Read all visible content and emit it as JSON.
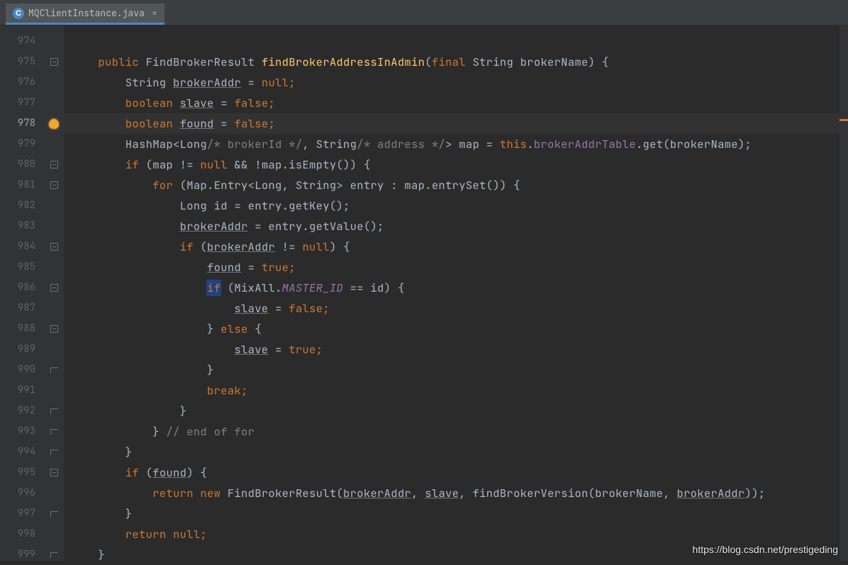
{
  "tab": {
    "filename": "MQClientInstance.java",
    "icon_letter": "C"
  },
  "gutter": {
    "start": 974,
    "end": 999,
    "current": 978
  },
  "code": {
    "l974": "",
    "l975_kw_public": "public",
    "l975_type": " FindBrokerResult ",
    "l975_method": "findBrokerAddressInAdmin",
    "l975_after": "(",
    "l975_final": "final",
    "l975_rest": " String brokerName) {",
    "l976_pre": "        String ",
    "l976_var": "brokerAddr",
    "l976_post": " = ",
    "l976_null": "null",
    "l976_semi": ";",
    "l977_pre": "        ",
    "l977_bool": "boolean ",
    "l977_var": "slave",
    "l977_eq": " = ",
    "l977_val": "false",
    "l977_semi": ";",
    "l978_pre": "        ",
    "l978_bool": "boolean ",
    "l978_var": "found",
    "l978_eq": " = ",
    "l978_val": "false",
    "l978_semi": ";",
    "l979_pre": "        HashMap<Long",
    "l979_c1": "/* brokerId */",
    "l979_mid": ", String",
    "l979_c2": "/* address */",
    "l979_mid2": "> map = ",
    "l979_this": "this",
    "l979_dot": ".",
    "l979_field": "brokerAddrTable",
    "l979_rest": ".get(brokerName);",
    "l980_pre": "        ",
    "l980_if": "if",
    "l980_rest": " (map != ",
    "l980_null": "null",
    "l980_mid": " && !map.isEmpty()) {",
    "l981_pre": "            ",
    "l981_for": "for",
    "l981_rest": " (Map.Entry<Long, String> entry : map.entrySet()) {",
    "l982_pre": "                Long id = entry.getKey();",
    "l983_pre": "                ",
    "l983_var": "brokerAddr",
    "l983_rest": " = entry.getValue();",
    "l984_pre": "                ",
    "l984_if": "if",
    "l984_op": " (",
    "l984_var": "brokerAddr",
    "l984_ne": " != ",
    "l984_null": "null",
    "l984_cl": ") {",
    "l985_pre": "                    ",
    "l985_var": "found",
    "l985_eq": " = ",
    "l985_val": "true",
    "l985_semi": ";",
    "l986_pre": "                    ",
    "l986_if": "if",
    "l986_op": " (MixAll.",
    "l986_static": "MASTER_ID",
    "l986_rest": " == id) {",
    "l987_pre": "                        ",
    "l987_var": "slave",
    "l987_eq": " = ",
    "l987_val": "false",
    "l987_semi": ";",
    "l988_pre": "                    } ",
    "l988_else": "else",
    "l988_rest": " {",
    "l989_pre": "                        ",
    "l989_var": "slave",
    "l989_eq": " = ",
    "l989_val": "true",
    "l989_semi": ";",
    "l990": "                    }",
    "l991_pre": "                    ",
    "l991_break": "break",
    "l991_semi": ";",
    "l992": "                }",
    "l993_pre": "            } ",
    "l993_c": "// end of for",
    "l994": "        }",
    "l995_pre": "        ",
    "l995_if": "if",
    "l995_op": " (",
    "l995_var": "found",
    "l995_cl": ") {",
    "l996_pre": "            ",
    "l996_ret": "return new",
    "l996_mid": " FindBrokerResult(",
    "l996_a": "brokerAddr",
    "l996_c1": ", ",
    "l996_b": "slave",
    "l996_c2": ", findBrokerVersion(brokerName, ",
    "l996_d": "brokerAddr",
    "l996_end": "));",
    "l997": "        }",
    "l998_pre": "        ",
    "l998_ret": "return ",
    "l998_null": "null",
    "l998_semi": ";",
    "l999": "    }"
  },
  "watermark": "https://blog.csdn.net/prestigeding"
}
